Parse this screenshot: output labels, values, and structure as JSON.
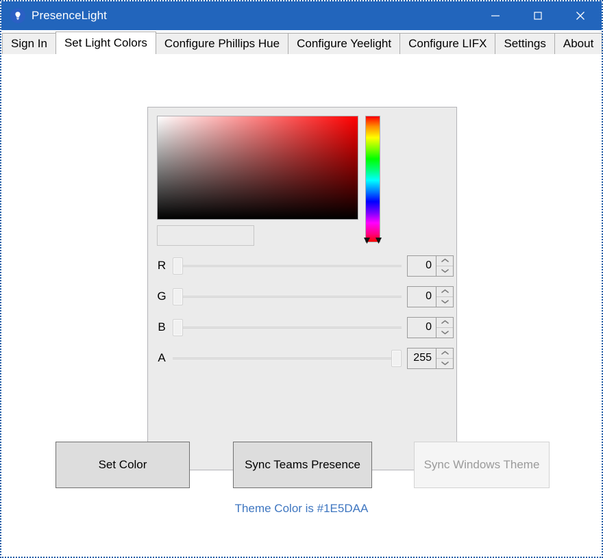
{
  "window": {
    "title": "PresenceLight",
    "icon": "lightbulb-icon",
    "titlebar_color": "#2265BC",
    "controls": {
      "minimize": "minimize-icon",
      "maximize": "maximize-icon",
      "close": "close-icon"
    }
  },
  "tabs": [
    {
      "label": "Sign In",
      "active": false
    },
    {
      "label": "Set Light Colors",
      "active": true
    },
    {
      "label": "Configure Phillips Hue",
      "active": false
    },
    {
      "label": "Configure Yeelight",
      "active": false
    },
    {
      "label": "Configure LIFX",
      "active": false
    },
    {
      "label": "Settings",
      "active": false
    },
    {
      "label": "About",
      "active": false
    }
  ],
  "color_picker": {
    "saturation_value_area": {
      "name": "saturation-value-gradient",
      "base_hue_color": "#FF0000",
      "top_left": "#FFFFFF",
      "top_right": "#FF0000",
      "bottom": "#000000"
    },
    "hue_slider": {
      "name": "hue-slider",
      "marker_position_percent": 100,
      "marker_hue": "#FF0000"
    },
    "hex_field": {
      "value": "",
      "placeholder": ""
    },
    "channels": [
      {
        "label": "R",
        "value": "0",
        "min": 0,
        "max": 255,
        "percent": 0
      },
      {
        "label": "G",
        "value": "0",
        "min": 0,
        "max": 255,
        "percent": 0
      },
      {
        "label": "B",
        "value": "0",
        "min": 0,
        "max": 255,
        "percent": 0
      },
      {
        "label": "A",
        "value": "255",
        "min": 0,
        "max": 255,
        "percent": 100
      }
    ]
  },
  "actions": {
    "set_color": {
      "label": "Set Color",
      "disabled": false
    },
    "sync_teams": {
      "label": "Sync Teams Presence",
      "disabled": false
    },
    "sync_windows": {
      "label": "Sync Windows Theme",
      "disabled": true
    }
  },
  "status": {
    "theme_color_text": "Theme Color is #1E5DAA",
    "theme_color_value": "#1E5DAA",
    "text_color": "#3E76C0"
  }
}
